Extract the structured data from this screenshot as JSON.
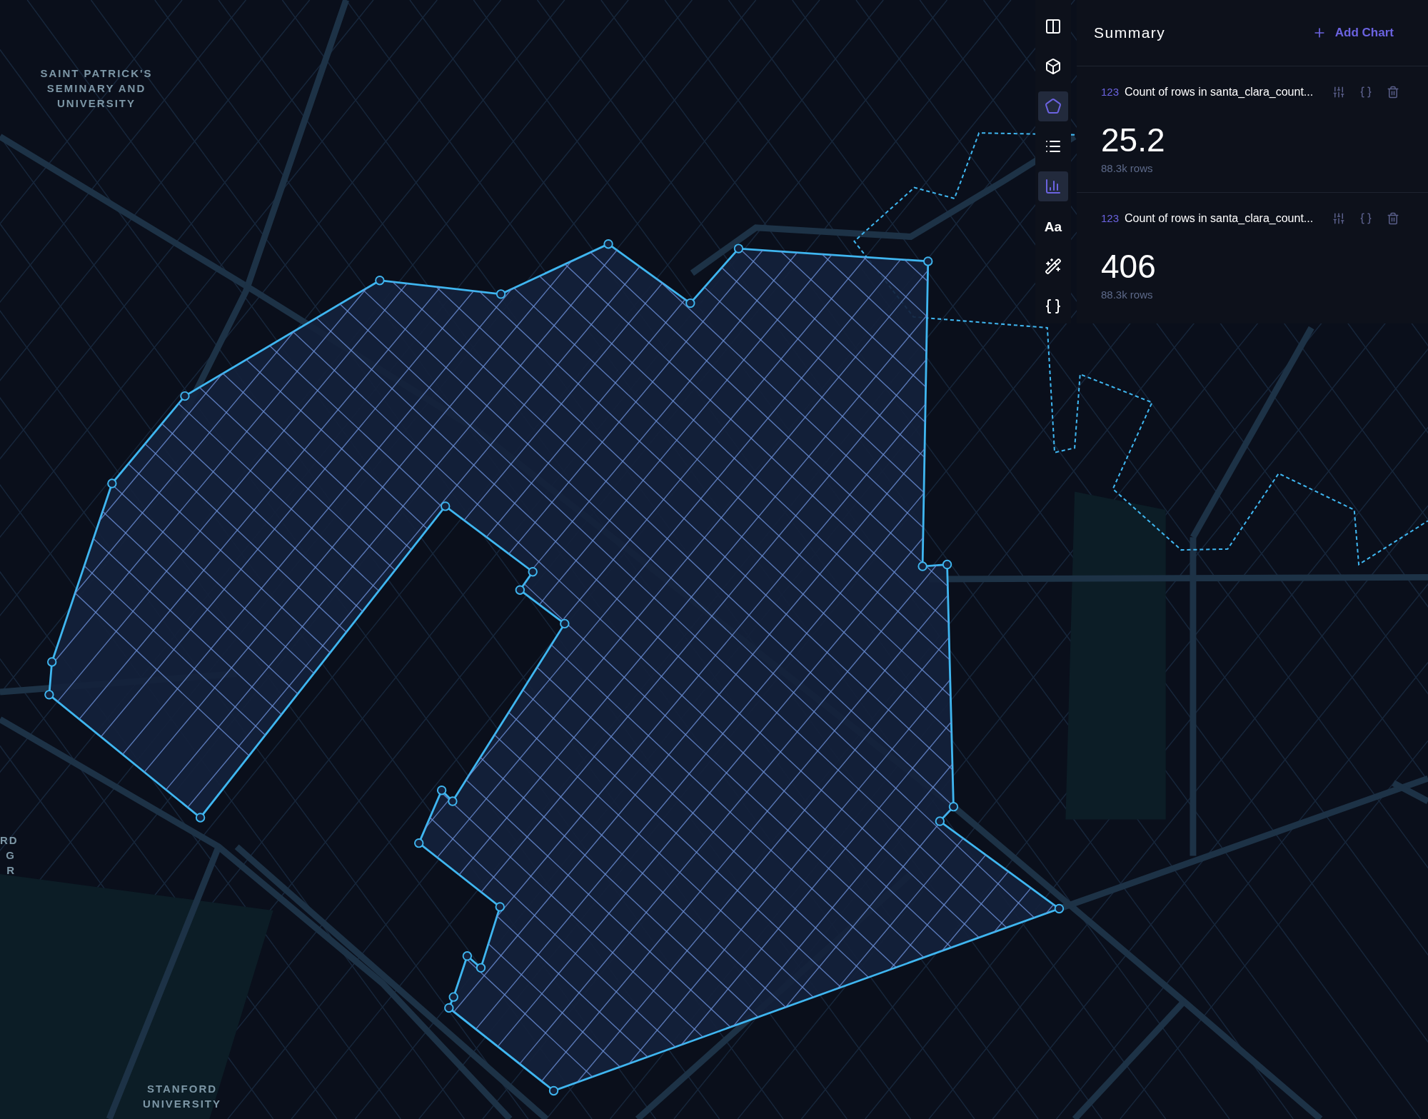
{
  "map": {
    "labels": [
      {
        "text": "SAINT PATRICK'S\nSEMINARY AND\nUNIVERSITY"
      },
      {
        "text": "RD\nG\nR"
      },
      {
        "text": "STANFORD\nUNIVERSITY"
      }
    ]
  },
  "toolbar": {
    "items": [
      {
        "kind": "split",
        "selected": false
      },
      {
        "kind": "cube",
        "selected": false
      },
      {
        "kind": "polygon",
        "selected": true
      },
      {
        "kind": "list",
        "selected": false
      },
      {
        "kind": "chart",
        "selected": true
      },
      {
        "kind": "text",
        "label": "Aa",
        "selected": false
      },
      {
        "kind": "wand",
        "selected": false
      },
      {
        "kind": "braces",
        "selected": false
      }
    ]
  },
  "summary": {
    "title": "Summary",
    "add_button": "Add Chart",
    "cards": [
      {
        "badge": "123",
        "title": "Count of rows in santa_clara_count...",
        "value": "25.2",
        "rows": "88.3k rows"
      },
      {
        "badge": "123",
        "title": "Count of rows in santa_clara_count...",
        "value": "406",
        "rows": "88.3k rows"
      }
    ]
  }
}
